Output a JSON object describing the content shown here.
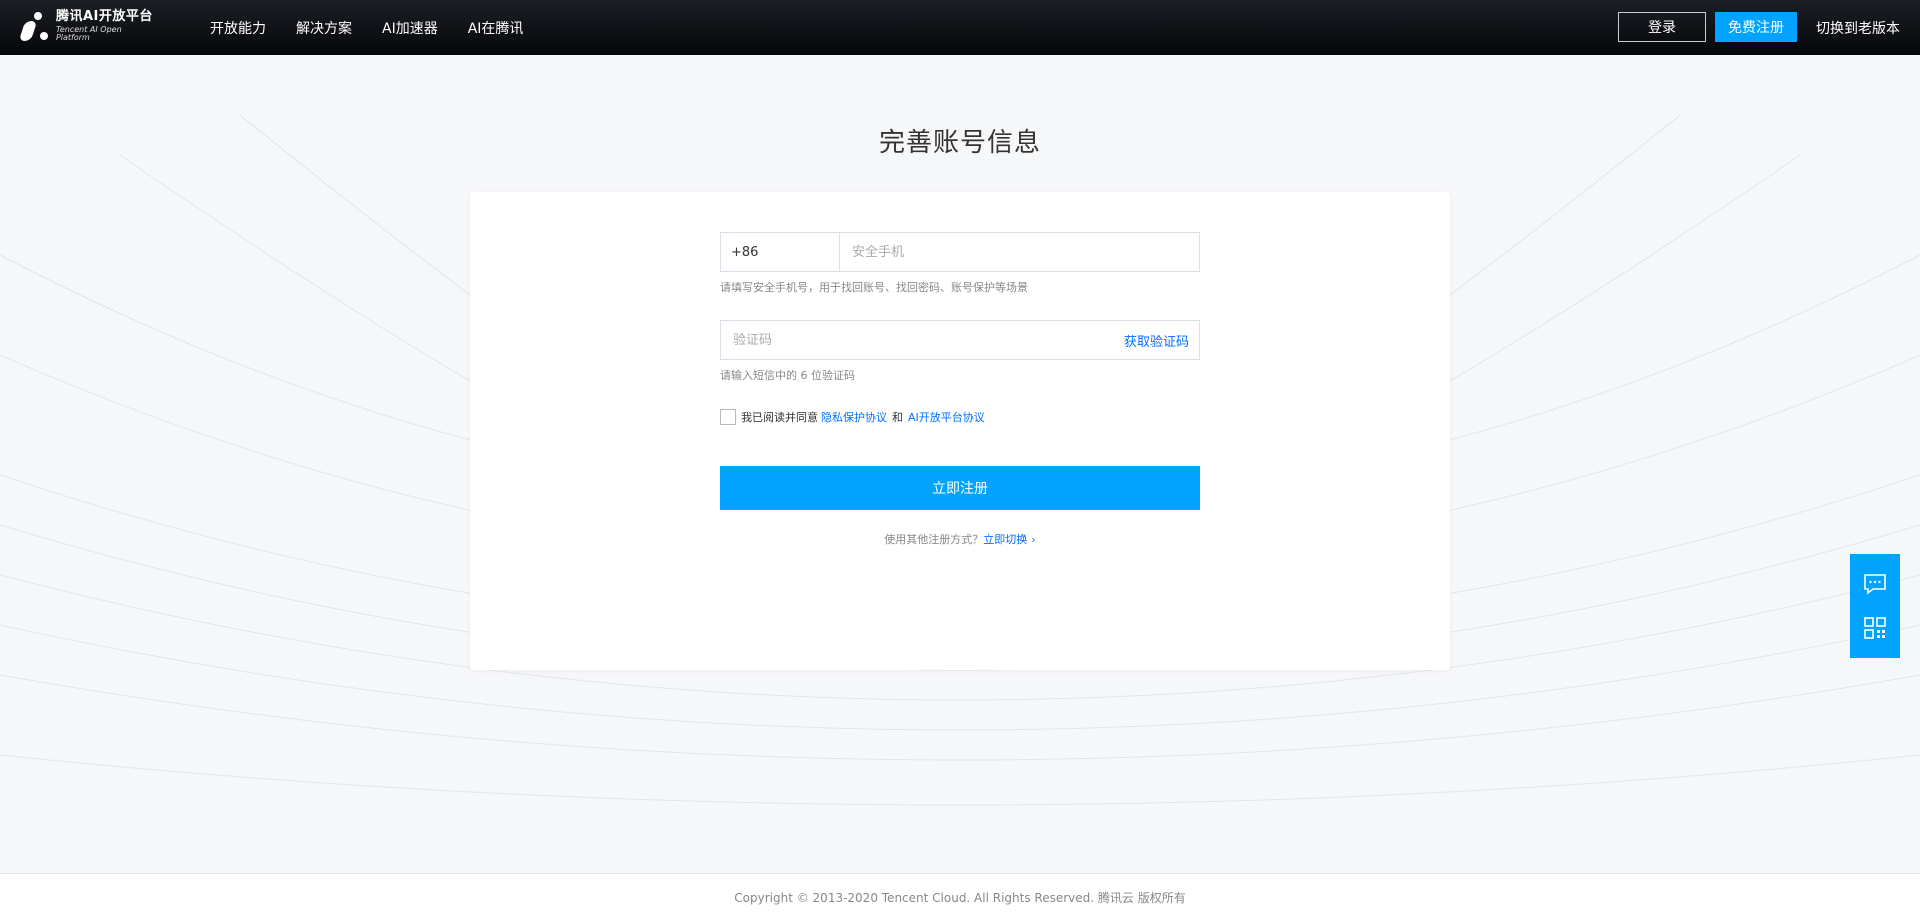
{
  "header": {
    "logo": {
      "title": "腾讯AI开放平台",
      "subtitle": "Tencent AI Open Platform"
    },
    "nav_items": [
      "开放能力",
      "解决方案",
      "AI加速器",
      "AI在腾讯"
    ],
    "login_label": "登录",
    "register_label": "免费注册",
    "switch_old_label": "切换到老版本"
  },
  "main": {
    "title": "完善账号信息",
    "phone": {
      "country_code": "+86",
      "placeholder": "安全手机",
      "hint": "请填写安全手机号，用于找回账号、找回密码、账号保护等场景"
    },
    "verify_code": {
      "placeholder": "验证码",
      "get_code_label": "获取验证码",
      "hint": "请输入短信中的 6 位验证码"
    },
    "agreement": {
      "prefix": "我已阅读并同意",
      "privacy_link": "隐私保护协议",
      "and": "和",
      "platform_link": "AI开放平台协议"
    },
    "submit_label": "立即注册",
    "other": {
      "prefix": "使用其他注册方式？",
      "link": "立即切换"
    }
  },
  "float_widget": {
    "icons": [
      "chat-icon",
      "qrcode-icon"
    ]
  },
  "footer": {
    "copyright": "Copyright © 2013-2020 Tencent Cloud. All Rights Reserved. 腾讯云 版权所有"
  },
  "colors": {
    "accent": "#00a4ff",
    "link": "#006eff",
    "header_bg": "#0d0f14",
    "page_bg": "#f6f7f9"
  }
}
